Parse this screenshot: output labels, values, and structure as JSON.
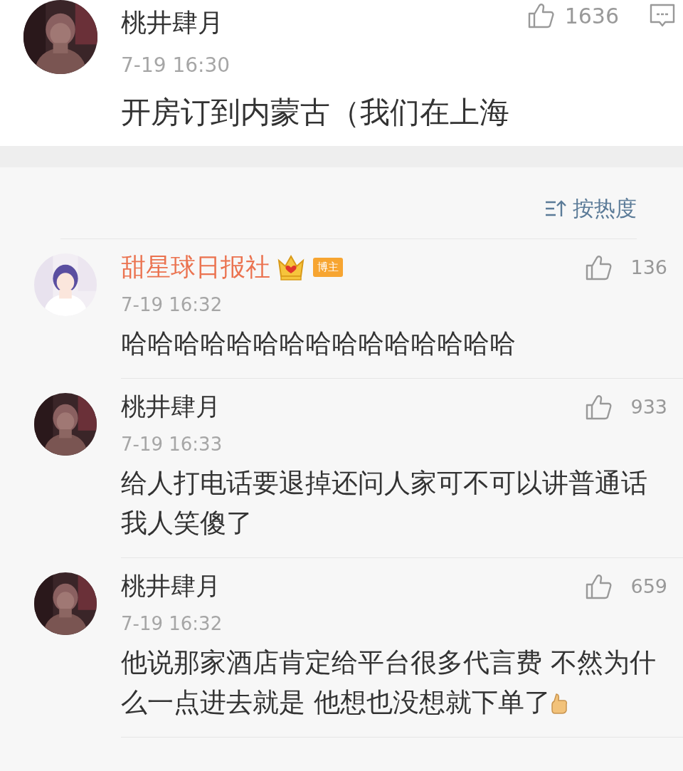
{
  "top_comment": {
    "user": "桃井肆月",
    "time": "7-19 16:30",
    "text": "开房订到内蒙古（我们在上海",
    "likes": "1636"
  },
  "sort": {
    "label": "按热度"
  },
  "replies": [
    {
      "user": "甜星球日报社",
      "vip": true,
      "badge": "博主",
      "time": "7-19 16:32",
      "text": "哈哈哈哈哈哈哈哈哈哈哈哈哈哈哈",
      "likes": "136",
      "trailing_emoji": false
    },
    {
      "user": "桃井肆月",
      "vip": false,
      "time": "7-19 16:33",
      "text": "给人打电话要退掉还问人家可不可以讲普通话我人笑傻了",
      "likes": "933",
      "trailing_emoji": false
    },
    {
      "user": "桃井肆月",
      "vip": false,
      "time": "7-19 16:32",
      "text": "他说那家酒店肯定给平台很多代言费 不然为什么一点进去就是 他想也没想就下单了",
      "likes": "659",
      "trailing_emoji": true
    }
  ]
}
